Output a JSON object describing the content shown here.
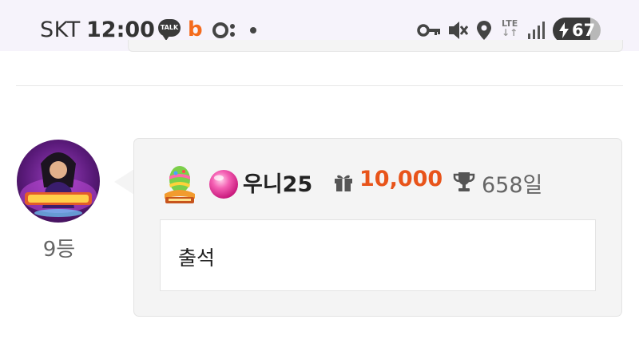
{
  "status_bar": {
    "carrier": "SKT",
    "time": "12:00",
    "talk_label": "TALK",
    "b_label": "b",
    "network": "LTE",
    "network_arrows": "↓↑",
    "battery": "67"
  },
  "post": {
    "rank": "9등",
    "username": "우니25",
    "points": "10,000",
    "days": "658일",
    "message": "출석",
    "points_color": "#e8541a"
  }
}
